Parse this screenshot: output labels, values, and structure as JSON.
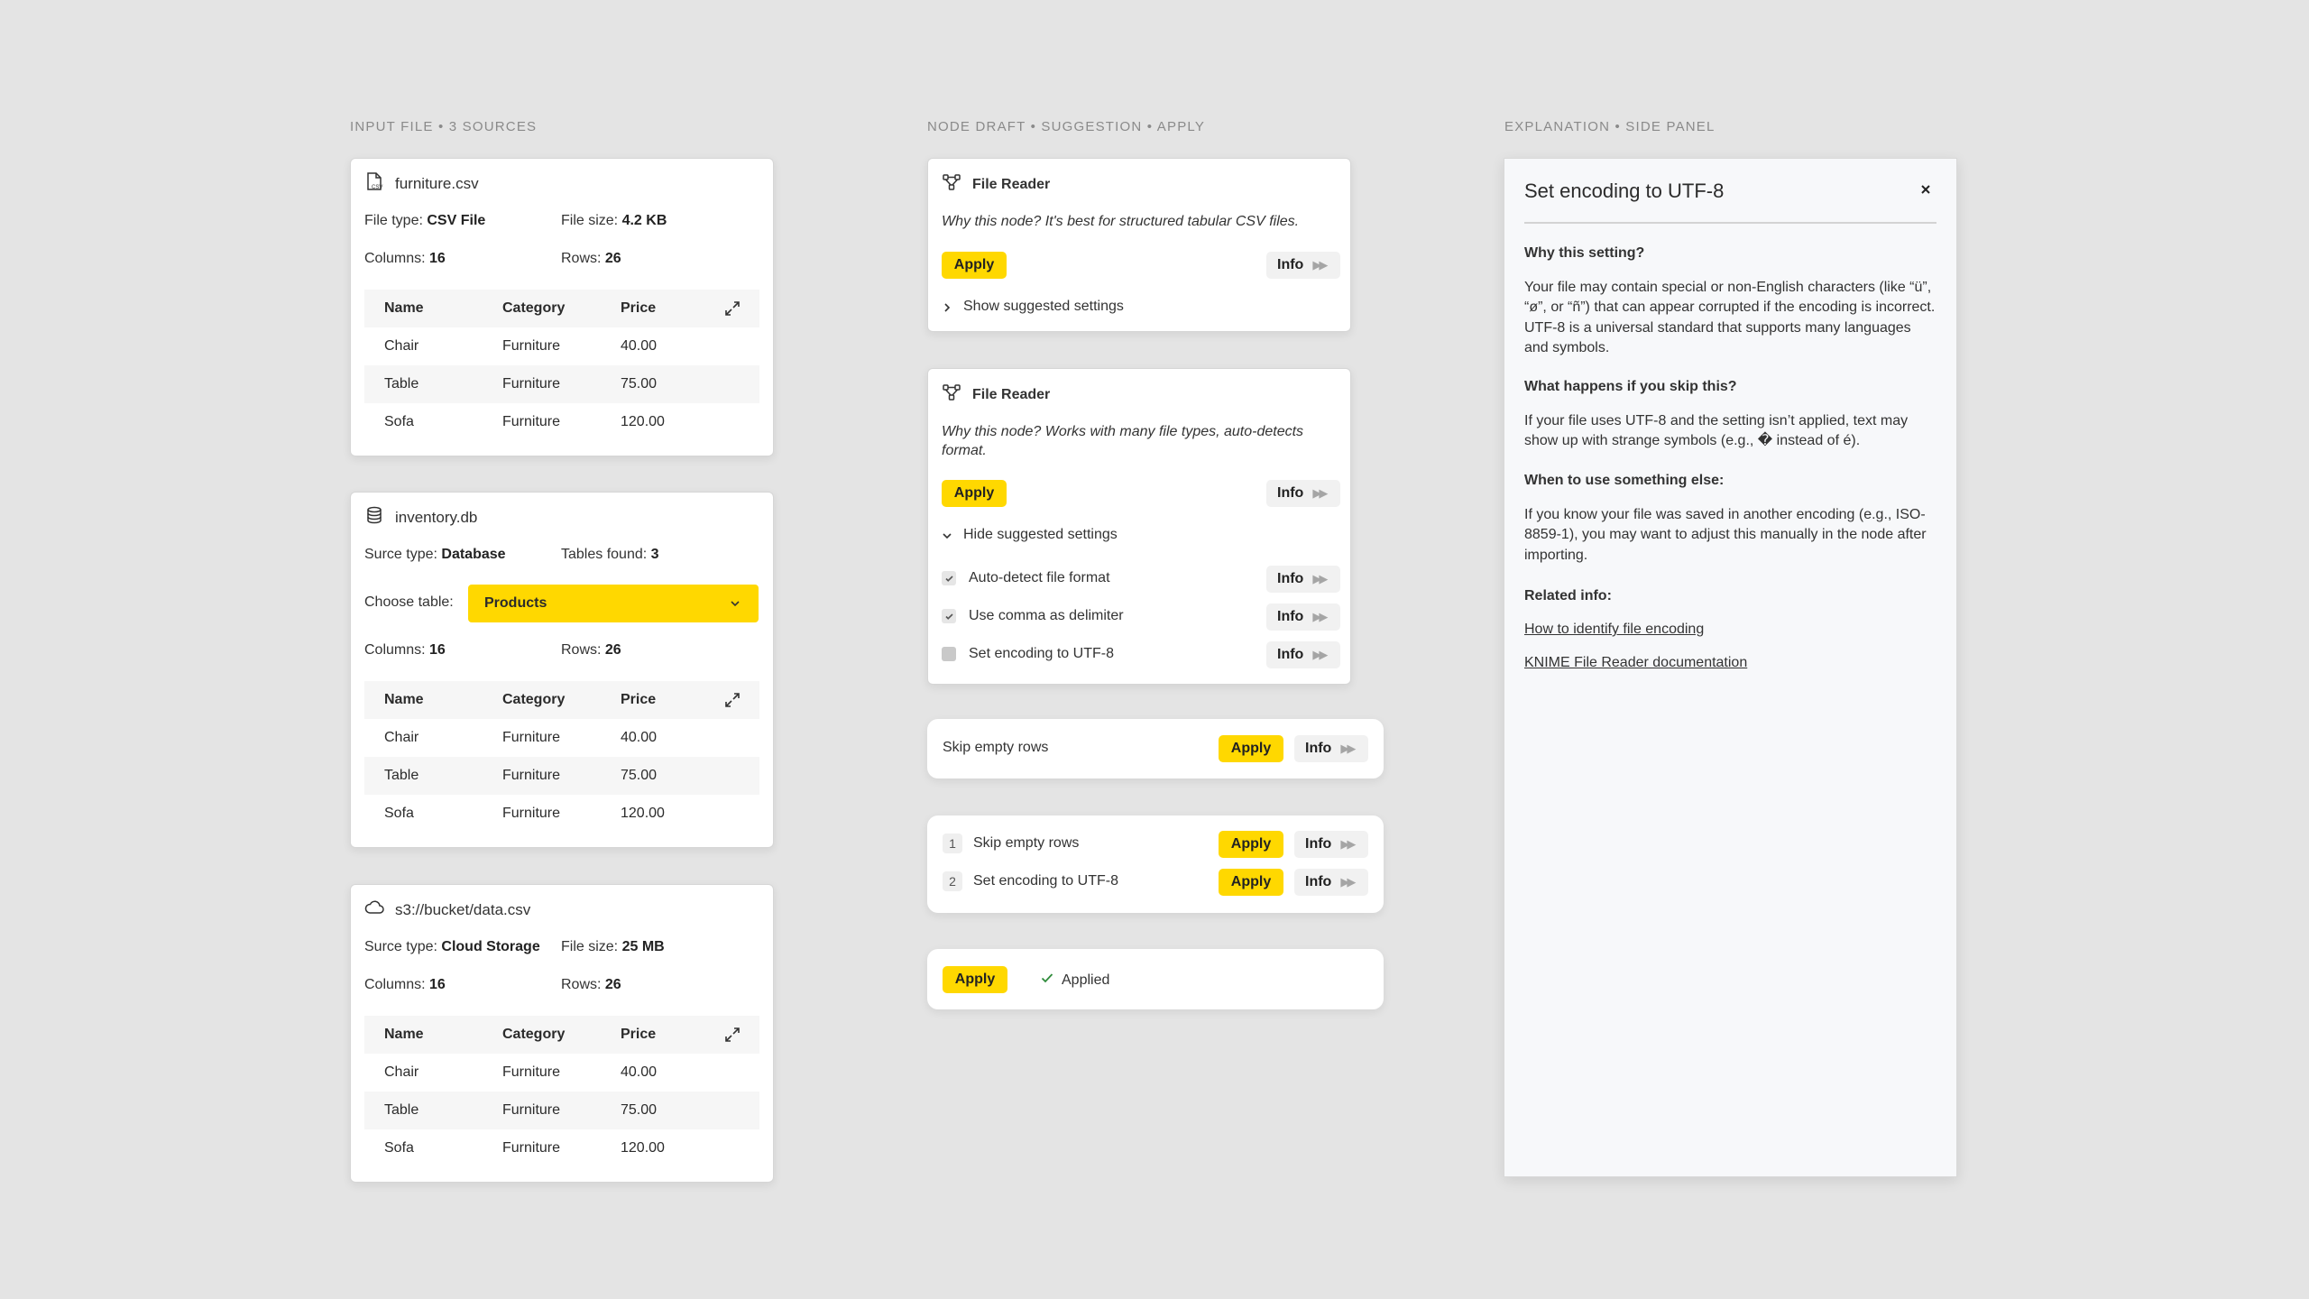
{
  "headings": {
    "input": "INPUT FILE • 3 SOURCES",
    "node": "NODE DRAFT • SUGGESTION • APPLY",
    "explain": "EXPLANATION • SIDE PANEL"
  },
  "sources": [
    {
      "name": "furniture.csv",
      "icon": "csv-file-icon",
      "meta1_label": "File type:",
      "meta1_value": "CSV File",
      "meta2_label": "File size:",
      "meta2_value": "4.2 KB",
      "columns_label": "Columns:",
      "columns": "16",
      "rows_label": "Rows:",
      "rows": "26"
    },
    {
      "name": "inventory.db",
      "icon": "database-icon",
      "meta1_label": "Surce type:",
      "meta1_value": "Database",
      "meta2_label": "Tables found:",
      "meta2_value": "3",
      "choose_label": "Choose table:",
      "choose_value": "Products",
      "columns_label": "Columns:",
      "columns": "16",
      "rows_label": "Rows:",
      "rows": "26"
    },
    {
      "name": "s3://bucket/data.csv",
      "icon": "cloud-icon",
      "meta1_label": "Surce type:",
      "meta1_value": "Cloud Storage",
      "meta2_label": "File size:",
      "meta2_value": "25 MB",
      "columns_label": "Columns:",
      "columns": "16",
      "rows_label": "Rows:",
      "rows": "26"
    }
  ],
  "preview": {
    "headers": [
      "Name",
      "Category",
      "Price"
    ],
    "rows": [
      [
        "Chair",
        "Furniture",
        "40.00"
      ],
      [
        "Table",
        "Furniture",
        "75.00"
      ],
      [
        "Sofa",
        "Furniture",
        "120.00"
      ]
    ]
  },
  "node1": {
    "title": "File Reader",
    "why": "Why this node? It's best for structured tabular CSV files.",
    "apply": "Apply",
    "info": "Info",
    "toggle": "Show suggested settings"
  },
  "node2": {
    "title": "File Reader",
    "why": "Why this node? Works with many file types, auto-detects format.",
    "apply": "Apply",
    "info": "Info",
    "toggle": "Hide suggested settings",
    "settings": [
      {
        "label": "Auto-detect file format",
        "checked": true,
        "info": "Info"
      },
      {
        "label": "Use comma as delimiter",
        "checked": true,
        "info": "Info"
      },
      {
        "label": "Set encoding to UTF-8",
        "checked": false,
        "info": "Info"
      }
    ]
  },
  "single": {
    "label": "Skip empty rows",
    "apply": "Apply",
    "info": "Info"
  },
  "multi": [
    {
      "num": "1",
      "label": "Skip empty rows",
      "apply": "Apply",
      "info": "Info"
    },
    {
      "num": "2",
      "label": "Set encoding to UTF-8",
      "apply": "Apply",
      "info": "Info"
    }
  ],
  "applied": {
    "apply": "Apply",
    "status": "Applied"
  },
  "panel": {
    "title": "Set encoding to UTF-8",
    "why_h": "Why this setting?",
    "why_p": "Your file may contain special or non-English characters (like “ü”, “ø”, or “ñ”) that can appear corrupted if the encoding is incorrect. UTF-8 is a universal standard that supports many languages and symbols.",
    "skip_h": "What happens if you skip this?",
    "skip_p": "If your file uses UTF-8 and the setting isn’t applied, text may show up with strange symbols (e.g., � instead of é).",
    "else_h": "When to use something else:",
    "else_p": "If you know your file was saved in another encoding (e.g., ISO-8859-1), you may want to adjust this manually in the node after importing.",
    "related_h": "Related info:",
    "link1": "How to identify file encoding",
    "link2": "KNIME File Reader documentation"
  },
  "colors": {
    "accent": "#ffd800",
    "background": "#e4e4e4",
    "success": "#2e8b3a"
  }
}
